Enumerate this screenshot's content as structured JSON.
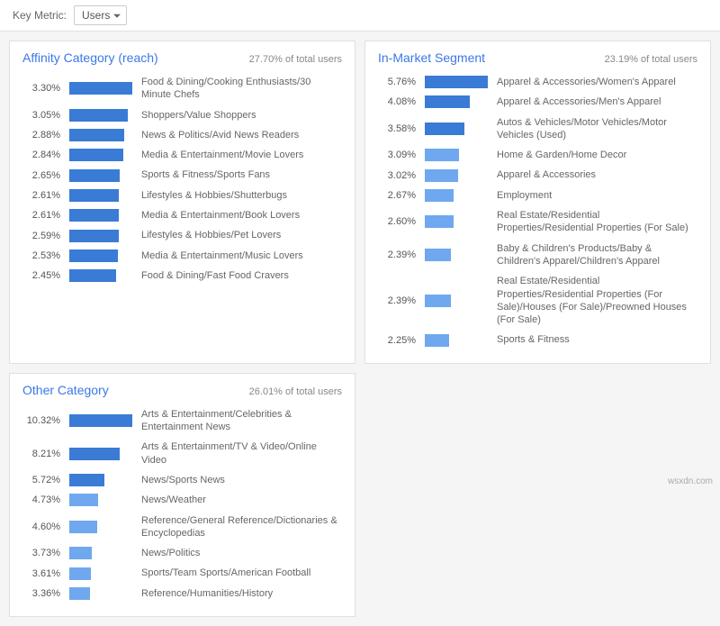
{
  "topbar": {
    "key_metric_label": "Key Metric:",
    "selected_metric": "Users"
  },
  "panels": {
    "affinity": {
      "title": "Affinity Category (reach)",
      "total": "27.70% of total users",
      "max": 3.3,
      "rows": [
        {
          "pct": "3.30%",
          "v": 3.3,
          "label": "Food & Dining/Cooking Enthusiasts/30 Minute Chefs"
        },
        {
          "pct": "3.05%",
          "v": 3.05,
          "label": "Shoppers/Value Shoppers"
        },
        {
          "pct": "2.88%",
          "v": 2.88,
          "label": "News & Politics/Avid News Readers"
        },
        {
          "pct": "2.84%",
          "v": 2.84,
          "label": "Media & Entertainment/Movie Lovers"
        },
        {
          "pct": "2.65%",
          "v": 2.65,
          "label": "Sports & Fitness/Sports Fans"
        },
        {
          "pct": "2.61%",
          "v": 2.61,
          "label": "Lifestyles & Hobbies/Shutterbugs"
        },
        {
          "pct": "2.61%",
          "v": 2.61,
          "label": "Media & Entertainment/Book Lovers"
        },
        {
          "pct": "2.59%",
          "v": 2.59,
          "label": "Lifestyles & Hobbies/Pet Lovers"
        },
        {
          "pct": "2.53%",
          "v": 2.53,
          "label": "Media & Entertainment/Music Lovers"
        },
        {
          "pct": "2.45%",
          "v": 2.45,
          "label": "Food & Dining/Fast Food Cravers"
        }
      ]
    },
    "inmarket": {
      "title": "In-Market Segment",
      "total": "23.19% of total users",
      "max": 5.76,
      "rows": [
        {
          "pct": "5.76%",
          "v": 5.76,
          "label": "Apparel & Accessories/Women's Apparel"
        },
        {
          "pct": "4.08%",
          "v": 4.08,
          "label": "Apparel & Accessories/Men's Apparel"
        },
        {
          "pct": "3.58%",
          "v": 3.58,
          "label": "Autos & Vehicles/Motor Vehicles/Motor Vehicles (Used)"
        },
        {
          "pct": "3.09%",
          "v": 3.09,
          "label": "Home & Garden/Home Decor"
        },
        {
          "pct": "3.02%",
          "v": 3.02,
          "label": "Apparel & Accessories"
        },
        {
          "pct": "2.67%",
          "v": 2.67,
          "label": "Employment"
        },
        {
          "pct": "2.60%",
          "v": 2.6,
          "label": "Real Estate/Residential Properties/Residential Properties (For Sale)"
        },
        {
          "pct": "2.39%",
          "v": 2.39,
          "label": "Baby & Children's Products/Baby & Children's Apparel/Children's Apparel"
        },
        {
          "pct": "2.39%",
          "v": 2.39,
          "label": "Real Estate/Residential Properties/Residential Properties (For Sale)/Houses (For Sale)/Preowned Houses (For Sale)"
        },
        {
          "pct": "2.25%",
          "v": 2.25,
          "label": "Sports & Fitness"
        }
      ]
    },
    "other": {
      "title": "Other Category",
      "total": "26.01% of total users",
      "max": 10.32,
      "rows": [
        {
          "pct": "10.32%",
          "v": 10.32,
          "label": "Arts & Entertainment/Celebrities & Entertainment News"
        },
        {
          "pct": "8.21%",
          "v": 8.21,
          "label": "Arts & Entertainment/TV & Video/Online Video"
        },
        {
          "pct": "5.72%",
          "v": 5.72,
          "label": "News/Sports News"
        },
        {
          "pct": "4.73%",
          "v": 4.73,
          "label": "News/Weather"
        },
        {
          "pct": "4.60%",
          "v": 4.6,
          "label": "Reference/General Reference/Dictionaries & Encyclopedias"
        },
        {
          "pct": "3.73%",
          "v": 3.73,
          "label": "News/Politics"
        },
        {
          "pct": "3.61%",
          "v": 3.61,
          "label": "Sports/Team Sports/American Football"
        },
        {
          "pct": "3.36%",
          "v": 3.36,
          "label": "Reference/Humanities/History"
        }
      ]
    }
  },
  "watermark": "wsxdn.com",
  "chart_data": [
    {
      "type": "bar",
      "title": "Affinity Category (reach)",
      "ylabel": "% of total users",
      "categories": [
        "Food & Dining/Cooking Enthusiasts/30 Minute Chefs",
        "Shoppers/Value Shoppers",
        "News & Politics/Avid News Readers",
        "Media & Entertainment/Movie Lovers",
        "Sports & Fitness/Sports Fans",
        "Lifestyles & Hobbies/Shutterbugs",
        "Media & Entertainment/Book Lovers",
        "Lifestyles & Hobbies/Pet Lovers",
        "Media & Entertainment/Music Lovers",
        "Food & Dining/Fast Food Cravers"
      ],
      "values": [
        3.3,
        3.05,
        2.88,
        2.84,
        2.65,
        2.61,
        2.61,
        2.59,
        2.53,
        2.45
      ]
    },
    {
      "type": "bar",
      "title": "In-Market Segment",
      "ylabel": "% of total users",
      "categories": [
        "Apparel & Accessories/Women's Apparel",
        "Apparel & Accessories/Men's Apparel",
        "Autos & Vehicles/Motor Vehicles/Motor Vehicles (Used)",
        "Home & Garden/Home Decor",
        "Apparel & Accessories",
        "Employment",
        "Real Estate/Residential Properties/Residential Properties (For Sale)",
        "Baby & Children's Products/Baby & Children's Apparel/Children's Apparel",
        "Real Estate/Residential Properties/Residential Properties (For Sale)/Houses (For Sale)/Preowned Houses (For Sale)",
        "Sports & Fitness"
      ],
      "values": [
        5.76,
        4.08,
        3.58,
        3.09,
        3.02,
        2.67,
        2.6,
        2.39,
        2.39,
        2.25
      ]
    },
    {
      "type": "bar",
      "title": "Other Category",
      "ylabel": "% of total users",
      "categories": [
        "Arts & Entertainment/Celebrities & Entertainment News",
        "Arts & Entertainment/TV & Video/Online Video",
        "News/Sports News",
        "News/Weather",
        "Reference/General Reference/Dictionaries & Encyclopedias",
        "News/Politics",
        "Sports/Team Sports/American Football",
        "Reference/Humanities/History"
      ],
      "values": [
        10.32,
        8.21,
        5.72,
        4.73,
        4.6,
        3.73,
        3.61,
        3.36
      ]
    }
  ]
}
